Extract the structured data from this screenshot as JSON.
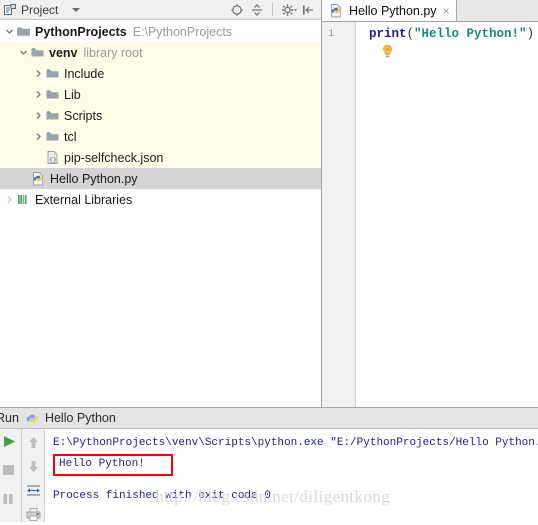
{
  "project_panel": {
    "header": {
      "icon": "project-icon",
      "title": "Project",
      "caret": "chevron-down-icon",
      "tools": [
        {
          "name": "locate-icon",
          "label": "Select Opened File"
        },
        {
          "name": "collapse-all-icon",
          "label": "Collapse All"
        },
        {
          "name": "gear-icon",
          "label": "Settings"
        },
        {
          "name": "hide-panel-icon",
          "label": "Hide"
        }
      ]
    },
    "tree": [
      {
        "label": "PythonProjects",
        "sub": "E:\\PythonProjects",
        "icon": "folder-icon",
        "arrow": "expanded",
        "depth": 0,
        "bold": true,
        "state": "normal"
      },
      {
        "label": "venv",
        "sub": "library root",
        "icon": "folder-lib-icon",
        "arrow": "expanded",
        "depth": 1,
        "bold": true,
        "state": "library"
      },
      {
        "label": "Include",
        "sub": "",
        "icon": "folder-lib-icon",
        "arrow": "collapsed",
        "depth": 2,
        "bold": false,
        "state": "library"
      },
      {
        "label": "Lib",
        "sub": "",
        "icon": "folder-lib-icon",
        "arrow": "collapsed",
        "depth": 2,
        "bold": false,
        "state": "library"
      },
      {
        "label": "Scripts",
        "sub": "",
        "icon": "folder-lib-icon",
        "arrow": "collapsed",
        "depth": 2,
        "bold": false,
        "state": "library"
      },
      {
        "label": "tcl",
        "sub": "",
        "icon": "folder-lib-icon",
        "arrow": "collapsed",
        "depth": 2,
        "bold": false,
        "state": "library"
      },
      {
        "label": "pip-selfcheck.json",
        "sub": "",
        "icon": "json-file-icon",
        "arrow": "none",
        "depth": 2,
        "bold": false,
        "state": "library"
      },
      {
        "label": "Hello Python.py",
        "sub": "",
        "icon": "python-file-icon",
        "arrow": "none",
        "depth": 1,
        "bold": false,
        "state": "selected"
      },
      {
        "label": "External Libraries",
        "sub": "",
        "icon": "external-libraries-icon",
        "arrow": "collapsed-dim",
        "depth": 0,
        "bold": false,
        "state": "normal"
      }
    ]
  },
  "editor": {
    "tab": {
      "label": "Hello Python.py",
      "icon": "python-file-icon",
      "close": "×"
    },
    "line_number": "1",
    "code": {
      "keyword": "print",
      "open_paren": "(",
      "string": "\"Hello Python!\"",
      "close_paren": ")"
    },
    "bulb_icon": "intention-bulb-icon"
  },
  "run_panel": {
    "header": {
      "tool_label": "Run",
      "config_icon": "python-config-icon",
      "config_name": "Hello Python"
    },
    "toolbar_left": [
      {
        "name": "rerun-icon",
        "label": "Rerun"
      },
      {
        "name": "stop-icon",
        "label": "Stop"
      },
      {
        "name": "pause-icon",
        "label": "Pause Output"
      }
    ],
    "toolbar_left2": [
      {
        "name": "up-arrow-icon",
        "label": "Up the Stack Trace"
      },
      {
        "name": "down-arrow-icon",
        "label": "Down the Stack Trace"
      },
      {
        "name": "soft-wrap-icon",
        "label": "Use Soft Wraps"
      },
      {
        "name": "print-icon",
        "label": "Print"
      }
    ],
    "console": {
      "command_line": "E:\\PythonProjects\\venv\\Scripts\\python.exe \"E:/PythonProjects/Hello Python.py\"",
      "output_line": "Hello Python!",
      "exit_line": "Process finished with exit code 0",
      "highlight_color": "#ff0000"
    }
  },
  "watermark": {
    "text": "http://blog.csdn.net/diligentkong"
  },
  "colors": {
    "library_bg": "#fdfde8",
    "selection_bg": "#d4d4d4",
    "console_text": "#21218a",
    "string_token": "#178a7a",
    "keyword_token": "#1d1d8f"
  }
}
